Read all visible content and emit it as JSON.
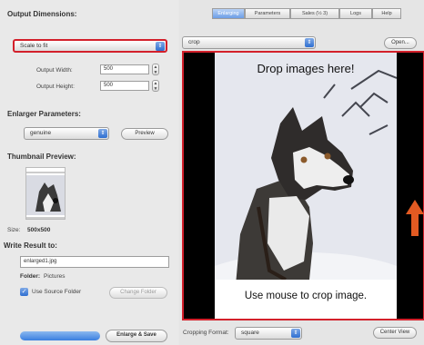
{
  "left_panel": {
    "output_dimensions_header": "Output Dimensions:",
    "output_mode_value": "Scale to fit",
    "output_width_label": "Output Width:",
    "output_width_value": "500",
    "output_height_label": "Output Height:",
    "output_height_value": "500",
    "enlarger_parameters_header": "Enlarger Parameters:",
    "enlarger_method_value": "genuine",
    "preview_button": "Preview",
    "thumbnail_header": "Thumbnail Preview:",
    "thumbnail_size_label": "Size:",
    "thumbnail_size_value": "500x500",
    "write_result_header": "Write Result to:",
    "output_filename_value": "enlarged1.jpg",
    "folder_label": "Folder:",
    "folder_value": "Pictures",
    "use_source_folder_label": "Use Source Folder",
    "change_folder_button": "Change Folder",
    "enlarge_save_button": "Enlarge & Save"
  },
  "right_panel": {
    "tabs": [
      {
        "label": "Enlarging",
        "active": true
      },
      {
        "label": "Parameters",
        "active": false
      },
      {
        "label": "Sales (½ 3)",
        "active": false
      },
      {
        "label": "Logs",
        "active": false
      },
      {
        "label": "Help",
        "active": false
      }
    ],
    "source_select_value": "crop",
    "open_button": "Open...",
    "drop_text": "Drop images here!",
    "crop_text": "Use mouse to crop image.",
    "cropping_format_label": "Cropping Format:",
    "cropping_format_value": "square",
    "center_view_button": "Center View"
  },
  "colors": {
    "highlight_red": "#d3202b",
    "accent_blue": "#2f6fd1"
  }
}
